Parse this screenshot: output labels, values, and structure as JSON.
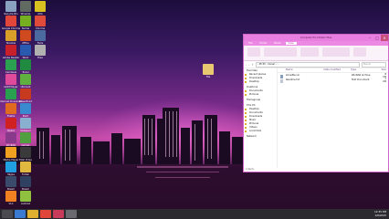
{
  "desktop": {
    "icons": [
      {
        "label": "Recycle Bin",
        "color": "#8aa0c0"
      },
      {
        "label": "Google Chrome",
        "color": "#e0463a"
      },
      {
        "label": "Shadow",
        "color": "#d8a028"
      },
      {
        "label": "Adobe Reader",
        "color": "#c8202a"
      },
      {
        "label": "Camtasia",
        "color": "#2aa050"
      },
      {
        "label": "GOM Player",
        "color": "#e04a9a"
      },
      {
        "label": "Internet Download",
        "color": "#28a050"
      },
      {
        "label": "Firefox",
        "color": "#e06a20"
      },
      {
        "label": "Opera",
        "color": "#d02020"
      },
      {
        "label": "WinRAR",
        "color": "#8a3a8a"
      },
      {
        "label": "Media Player",
        "color": "#f0a020"
      },
      {
        "label": "Skype",
        "color": "#20a0e0"
      },
      {
        "label": "Steam",
        "color": "#3a4a6a"
      },
      {
        "label": "VLC",
        "color": "#f08020"
      },
      {
        "label": "Winamp",
        "color": "#606a60"
      },
      {
        "label": "Nvidia",
        "color": "#76b020"
      },
      {
        "label": "Office",
        "color": "#d04a20"
      },
      {
        "label": "Word",
        "color": "#2a5ab0"
      },
      {
        "label": "Excel",
        "color": "#208a40"
      },
      {
        "label": "Utorrent",
        "color": "#60b040"
      },
      {
        "label": "PowerPoint",
        "color": "#c83a20"
      },
      {
        "label": "Paint",
        "color": "#3a8ad0"
      },
      {
        "label": "Notepad",
        "color": "#8ab0d0"
      },
      {
        "label": "Games",
        "color": "#50a040"
      },
      {
        "label": "Total Video",
        "color": "#3a3a3a"
      },
      {
        "label": "Folder",
        "color": "#e0b840"
      },
      {
        "label": "Steam",
        "color": "#304060"
      },
      {
        "label": "Android",
        "color": "#90c040"
      },
      {
        "label": "AVG",
        "color": "#d8c020"
      },
      {
        "label": "Chrome",
        "color": "#e04a3a"
      },
      {
        "label": "Tools",
        "color": "#4a6aa0"
      },
      {
        "label": "Files",
        "color": "#b0b0b0"
      }
    ],
    "center_icon_label": "File"
  },
  "window": {
    "title": "Computer Pro Hidden Files",
    "ribbon_tabs": [
      "File",
      "Home",
      "Share",
      "View"
    ],
    "active_tab": "View",
    "address": "› Mi PC › Kanal › ...",
    "search_placeholder": "Buscar",
    "nav_items": [
      {
        "label": "Favorites",
        "header": true
      },
      {
        "label": "Recent places",
        "header": false
      },
      {
        "label": "Downloads",
        "header": false
      },
      {
        "label": "Desktop",
        "header": false
      },
      {
        "label": "OneDrive",
        "header": true
      },
      {
        "label": "Documents",
        "header": false
      },
      {
        "label": "Pictures",
        "header": false
      },
      {
        "label": "Homegroup",
        "header": true
      },
      {
        "label": "This PC",
        "header": true
      },
      {
        "label": "Desktop",
        "header": false
      },
      {
        "label": "Documents",
        "header": false
      },
      {
        "label": "Downloads",
        "header": false
      },
      {
        "label": "Music",
        "header": false
      },
      {
        "label": "Pictures",
        "header": false
      },
      {
        "label": "Videos",
        "header": false
      },
      {
        "label": "Local Disk",
        "header": false
      },
      {
        "label": "Network",
        "header": true
      }
    ],
    "columns": [
      "Name",
      "Date modified",
      "Type",
      "Size"
    ],
    "files": [
      {
        "name": "showfile.rar",
        "date": "",
        "type": "WinRAR archive",
        "size": "8 KB"
      },
      {
        "name": "Readme.txt",
        "date": "",
        "type": "Text Document",
        "size": "1 KB"
      }
    ],
    "status": "2 items"
  },
  "taskbar": {
    "items": [
      {
        "name": "start",
        "color": "#4a4a50"
      },
      {
        "name": "ie",
        "color": "#3a7ad0"
      },
      {
        "name": "explorer",
        "color": "#e0b030"
      },
      {
        "name": "chrome",
        "color": "#e0463a"
      },
      {
        "name": "media",
        "color": "#c83a5a"
      },
      {
        "name": "app",
        "color": "#6a6a70"
      }
    ],
    "time": "12:35 PM",
    "date": "1/6/2015"
  }
}
